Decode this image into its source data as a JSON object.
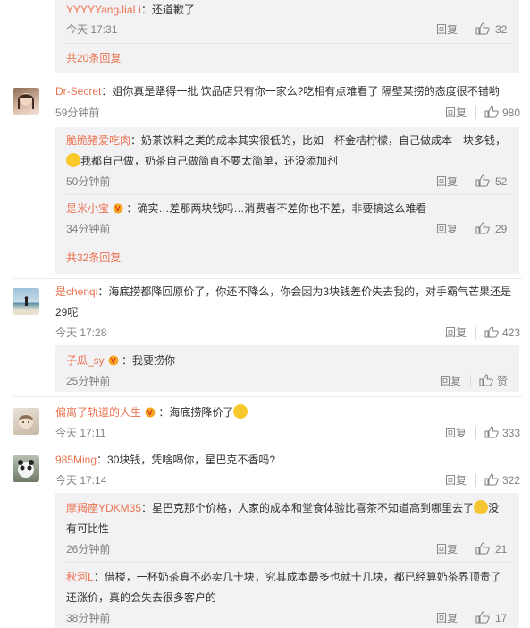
{
  "c0": {
    "replies": [
      {
        "user": "YYYYYangJiaLi",
        "text": "还道歉了",
        "time": "今天 17:31",
        "like": "32"
      }
    ],
    "more": "共20条回复"
  },
  "c1": {
    "user": "Dr-Secret",
    "text": "姐你真是犟得一批 饮品店只有你一家么?吃相有点难看了 隔壁某捞的态度很不错哟",
    "time": "59分钟前",
    "like": "980",
    "replies": [
      {
        "user": "脆脆猪爱吃肉",
        "text1": "奶茶饮料之类的成本其实很低的，比如一杯金桔柠檬，自己做成本一块多钱，",
        "text2": "我都自己做，奶茶自己做简直不要太简单，还没添加剂",
        "time": "50分钟前",
        "like": "52"
      },
      {
        "user": "是米小宝",
        "text": "确实…差那两块钱吗…消费者不差你也不差，非要搞这么难看",
        "time": "34分钟前",
        "like": "29"
      }
    ],
    "more": "共32条回复"
  },
  "c2": {
    "user": "是chenqi",
    "text1": "海底捞都降回原价了，你还不降么，你会因为3块钱差价失去我的，对手霸气芒果还是",
    "text2": "29呢",
    "time": "今天 17:28",
    "like": "423",
    "replies": [
      {
        "user": "子瓜_sy",
        "text": "我要捞你",
        "time": "25分钟前",
        "like": "赞"
      }
    ]
  },
  "c3": {
    "user": "偏离了轨道的人生",
    "text": "海底捞降价了",
    "time": "今天 17:11",
    "like": "333"
  },
  "c4": {
    "user": "985Ming",
    "text": "30块钱，凭啥喝你，星巴克不香吗?",
    "time": "今天 17:14",
    "like": "322",
    "replies": [
      {
        "user": "摩羯座YDKM35",
        "text1": "星巴克那个价格，人家的成本和堂食体验比喜茶不知道高到哪里去了",
        "text1b": "没",
        "text2": "有可比性",
        "time": "26分钟前",
        "like": "21"
      },
      {
        "user": "秋河L",
        "text1": "借楼，一杯奶茶真不必卖几十块，究其成本最多也就十几块，都已经算奶茶界顶贵了",
        "text2": "还涨价，真的会失去很多客户的",
        "time": "38分钟前",
        "like": "17"
      }
    ]
  },
  "labels": {
    "reply": "回复",
    "colon": "："
  }
}
